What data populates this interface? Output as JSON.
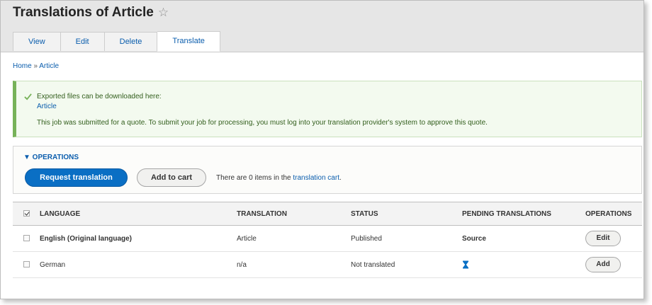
{
  "page": {
    "title": "Translations of Article"
  },
  "icons": {
    "favorite": "star-outline-icon",
    "status_ok": "check-icon",
    "pending": "hourglass-icon"
  },
  "colors": {
    "link": "#0a5dad",
    "primary_button": "#0a6fc4",
    "success_text": "#325e1c",
    "success_border": "#77b259"
  },
  "tabs": [
    {
      "label": "View",
      "active": false
    },
    {
      "label": "Edit",
      "active": false
    },
    {
      "label": "Delete",
      "active": false
    },
    {
      "label": "Translate",
      "active": true
    }
  ],
  "breadcrumb": {
    "items": [
      "Home",
      "Article"
    ],
    "separator": "»"
  },
  "message": {
    "line1": "Exported files can be downloaded here:",
    "link": "Article",
    "line2": "This job was submitted for a quote. To submit your job for processing, you must log into your translation provider's system to approve this quote."
  },
  "operations": {
    "summary": "▼ OPERATIONS",
    "request_button": "Request translation",
    "cart_button": "Add to cart",
    "cart_text_prefix": "There are 0 items in the ",
    "cart_link": "translation cart",
    "cart_text_suffix": "."
  },
  "table": {
    "headers": [
      "LANGUAGE",
      "TRANSLATION",
      "STATUS",
      "PENDING TRANSLATIONS",
      "OPERATIONS"
    ],
    "rows": [
      {
        "language": "English (Original language)",
        "translation": "Article",
        "status": "Published",
        "pending": "Source",
        "operation": "Edit"
      },
      {
        "language": "German",
        "translation": "n/a",
        "status": "Not translated",
        "pending": "",
        "operation": "Add"
      }
    ]
  }
}
